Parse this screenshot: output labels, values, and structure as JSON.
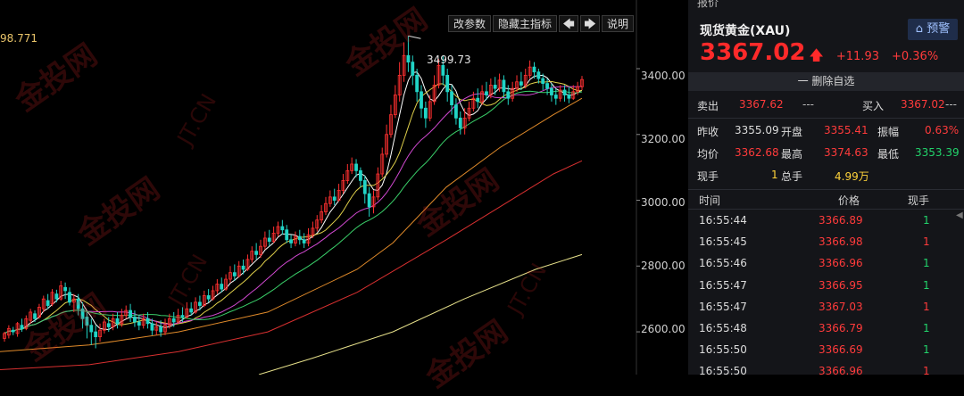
{
  "toolbar": {
    "modify_params": "改参数",
    "hide_indicator": "隐藏主指标",
    "left_arrow": "🡄",
    "right_arrow": "🡆",
    "help": "说明"
  },
  "chart": {
    "top_left_value": "98.771",
    "peak_label": "3499.73"
  },
  "chart_data": {
    "type": "candlestick",
    "peak": 3499.73,
    "y_ticks": [
      "3400.00",
      "3200.00",
      "3000.00",
      "2800.00",
      "2600.00"
    ],
    "ylim": [
      2470,
      3560
    ],
    "candles": [
      [
        2580,
        2595,
        2570,
        2600
      ],
      [
        2590,
        2610,
        2580,
        2620
      ],
      [
        2605,
        2600,
        2590,
        2615
      ],
      [
        2595,
        2625,
        2585,
        2630
      ],
      [
        2620,
        2610,
        2600,
        2640
      ],
      [
        2610,
        2640,
        2605,
        2650
      ],
      [
        2635,
        2660,
        2625,
        2670
      ],
      [
        2655,
        2640,
        2630,
        2665
      ],
      [
        2645,
        2675,
        2640,
        2685
      ],
      [
        2670,
        2700,
        2660,
        2710
      ],
      [
        2695,
        2680,
        2670,
        2715
      ],
      [
        2685,
        2720,
        2678,
        2730
      ],
      [
        2715,
        2700,
        2690,
        2728
      ],
      [
        2700,
        2740,
        2695,
        2755
      ],
      [
        2735,
        2725,
        2700,
        2750
      ],
      [
        2720,
        2690,
        2680,
        2735
      ],
      [
        2690,
        2700,
        2660,
        2715
      ],
      [
        2700,
        2670,
        2650,
        2715
      ],
      [
        2670,
        2640,
        2610,
        2690
      ],
      [
        2645,
        2620,
        2580,
        2660
      ],
      [
        2620,
        2600,
        2560,
        2640
      ],
      [
        2600,
        2585,
        2550,
        2620
      ],
      [
        2585,
        2605,
        2570,
        2625
      ],
      [
        2605,
        2630,
        2595,
        2640
      ],
      [
        2625,
        2615,
        2600,
        2645
      ],
      [
        2615,
        2640,
        2605,
        2655
      ],
      [
        2640,
        2625,
        2610,
        2660
      ],
      [
        2625,
        2650,
        2615,
        2670
      ],
      [
        2650,
        2665,
        2640,
        2680
      ],
      [
        2665,
        2645,
        2630,
        2685
      ],
      [
        2645,
        2630,
        2615,
        2665
      ],
      [
        2630,
        2620,
        2605,
        2650
      ],
      [
        2620,
        2640,
        2610,
        2655
      ],
      [
        2640,
        2625,
        2610,
        2660
      ],
      [
        2625,
        2605,
        2590,
        2640
      ],
      [
        2605,
        2615,
        2590,
        2630
      ],
      [
        2615,
        2600,
        2585,
        2635
      ],
      [
        2600,
        2620,
        2590,
        2640
      ],
      [
        2620,
        2640,
        2610,
        2655
      ],
      [
        2640,
        2630,
        2615,
        2660
      ],
      [
        2630,
        2650,
        2625,
        2670
      ],
      [
        2650,
        2645,
        2630,
        2675
      ],
      [
        2645,
        2670,
        2640,
        2690
      ],
      [
        2670,
        2660,
        2650,
        2690
      ],
      [
        2660,
        2690,
        2655,
        2705
      ],
      [
        2690,
        2680,
        2665,
        2710
      ],
      [
        2680,
        2710,
        2675,
        2725
      ],
      [
        2710,
        2700,
        2690,
        2730
      ],
      [
        2700,
        2725,
        2695,
        2740
      ],
      [
        2725,
        2745,
        2715,
        2760
      ],
      [
        2745,
        2730,
        2720,
        2765
      ],
      [
        2730,
        2760,
        2725,
        2775
      ],
      [
        2760,
        2780,
        2750,
        2800
      ],
      [
        2780,
        2770,
        2755,
        2805
      ],
      [
        2770,
        2800,
        2765,
        2815
      ],
      [
        2800,
        2790,
        2775,
        2820
      ],
      [
        2790,
        2820,
        2785,
        2835
      ],
      [
        2820,
        2845,
        2810,
        2860
      ],
      [
        2845,
        2835,
        2820,
        2870
      ],
      [
        2835,
        2860,
        2825,
        2880
      ],
      [
        2860,
        2885,
        2850,
        2905
      ],
      [
        2885,
        2875,
        2860,
        2910
      ],
      [
        2875,
        2900,
        2870,
        2920
      ],
      [
        2900,
        2920,
        2890,
        2935
      ],
      [
        2920,
        2910,
        2895,
        2940
      ],
      [
        2910,
        2880,
        2870,
        2925
      ],
      [
        2880,
        2870,
        2855,
        2895
      ],
      [
        2870,
        2890,
        2860,
        2905
      ],
      [
        2890,
        2880,
        2865,
        2910
      ],
      [
        2880,
        2870,
        2855,
        2900
      ],
      [
        2870,
        2895,
        2860,
        2915
      ],
      [
        2895,
        2915,
        2885,
        2935
      ],
      [
        2915,
        2940,
        2905,
        2955
      ],
      [
        2940,
        2965,
        2930,
        2985
      ],
      [
        2965,
        2990,
        2955,
        3010
      ],
      [
        2990,
        3010,
        2980,
        3030
      ],
      [
        3010,
        3000,
        2985,
        3035
      ],
      [
        3000,
        3030,
        2995,
        3050
      ],
      [
        3030,
        3060,
        3020,
        3080
      ],
      [
        3060,
        3090,
        3050,
        3110
      ],
      [
        3090,
        3110,
        3080,
        3130
      ],
      [
        3110,
        3090,
        3070,
        3125
      ],
      [
        3090,
        3060,
        3040,
        3100
      ],
      [
        3060,
        3020,
        2990,
        3075
      ],
      [
        3020,
        2980,
        2950,
        3040
      ],
      [
        2980,
        3010,
        2960,
        3030
      ],
      [
        3010,
        3080,
        3000,
        3100
      ],
      [
        3080,
        3140,
        3070,
        3160
      ],
      [
        3140,
        3200,
        3130,
        3230
      ],
      [
        3200,
        3260,
        3190,
        3290
      ],
      [
        3260,
        3320,
        3250,
        3350
      ],
      [
        3320,
        3380,
        3300,
        3420
      ],
      [
        3380,
        3440,
        3360,
        3480
      ],
      [
        3440,
        3420,
        3390,
        3500
      ],
      [
        3420,
        3380,
        3350,
        3440
      ],
      [
        3380,
        3330,
        3300,
        3400
      ],
      [
        3330,
        3280,
        3250,
        3350
      ],
      [
        3280,
        3250,
        3220,
        3300
      ],
      [
        3250,
        3300,
        3240,
        3320
      ],
      [
        3300,
        3350,
        3290,
        3380
      ],
      [
        3350,
        3410,
        3340,
        3430
      ],
      [
        3410,
        3380,
        3350,
        3440
      ],
      [
        3380,
        3330,
        3300,
        3400
      ],
      [
        3330,
        3290,
        3260,
        3350
      ],
      [
        3290,
        3250,
        3230,
        3310
      ],
      [
        3250,
        3220,
        3200,
        3270
      ],
      [
        3220,
        3250,
        3200,
        3280
      ],
      [
        3250,
        3280,
        3240,
        3300
      ],
      [
        3280,
        3310,
        3270,
        3330
      ],
      [
        3310,
        3300,
        3280,
        3340
      ],
      [
        3300,
        3330,
        3290,
        3350
      ],
      [
        3330,
        3320,
        3305,
        3360
      ],
      [
        3320,
        3350,
        3310,
        3370
      ],
      [
        3350,
        3340,
        3320,
        3375
      ],
      [
        3340,
        3365,
        3330,
        3385
      ],
      [
        3365,
        3330,
        3310,
        3380
      ],
      [
        3330,
        3310,
        3290,
        3350
      ],
      [
        3310,
        3340,
        3300,
        3360
      ],
      [
        3340,
        3360,
        3330,
        3380
      ],
      [
        3360,
        3350,
        3335,
        3390
      ],
      [
        3350,
        3380,
        3340,
        3400
      ],
      [
        3380,
        3405,
        3370,
        3425
      ],
      [
        3405,
        3390,
        3370,
        3420
      ],
      [
        3390,
        3370,
        3355,
        3400
      ],
      [
        3370,
        3355,
        3335,
        3385
      ],
      [
        3355,
        3340,
        3320,
        3370
      ],
      [
        3340,
        3320,
        3300,
        3355
      ],
      [
        3320,
        3310,
        3290,
        3340
      ],
      [
        3310,
        3335,
        3300,
        3350
      ],
      [
        3335,
        3320,
        3300,
        3350
      ],
      [
        3320,
        3310,
        3295,
        3345
      ],
      [
        3310,
        3330,
        3305,
        3350
      ],
      [
        3330,
        3345,
        3320,
        3360
      ],
      [
        3345,
        3367,
        3335,
        3378
      ]
    ]
  },
  "panel": {
    "tab": "报价",
    "title": "现货黄金(XAU)",
    "watch_label": "预警",
    "price": "3367.02",
    "price_arrow": "🡅",
    "change": "+11.93",
    "change_pct": "+0.36%",
    "remove_label": "一 删除自选",
    "stats": [
      [
        {
          "l": "卖出",
          "v": "3367.62",
          "c": "red"
        },
        {
          "l": "---",
          "v": "",
          "c": "gray"
        },
        {
          "l": "买入",
          "v": "3367.02",
          "c": "red"
        },
        {
          "l": "---",
          "v": "",
          "c": "gray"
        }
      ],
      [
        {
          "l": "昨收",
          "v": "3355.09",
          "c": "white"
        },
        {
          "l": "开盘",
          "v": "3355.41",
          "c": "red"
        },
        {
          "l": "振幅",
          "v": "0.63%",
          "c": "red"
        }
      ],
      [
        {
          "l": "均价",
          "v": "3362.68",
          "c": "red"
        },
        {
          "l": "最高",
          "v": "3374.63",
          "c": "red"
        },
        {
          "l": "最低",
          "v": "3353.39",
          "c": "green"
        }
      ],
      [
        {
          "l": "现手",
          "v": "1",
          "c": "yellow"
        },
        {
          "l": "总手",
          "v": "4.99万",
          "c": "yellow"
        }
      ]
    ],
    "tick_header": {
      "time": "时间",
      "price": "价格",
      "vol": "现手"
    },
    "ticks": [
      {
        "time": "16:55:44",
        "price": "3366.89",
        "vol": "1"
      },
      {
        "time": "16:55:45",
        "price": "3366.98",
        "vol": "1"
      },
      {
        "time": "16:55:46",
        "price": "3366.96",
        "vol": "1"
      },
      {
        "time": "16:55:47",
        "price": "3366.95",
        "vol": "1"
      },
      {
        "time": "16:55:47",
        "price": "3367.03",
        "vol": "1"
      },
      {
        "time": "16:55:48",
        "price": "3366.79",
        "vol": "1"
      },
      {
        "time": "16:55:50",
        "price": "3366.69",
        "vol": "1"
      },
      {
        "time": "16:55:50",
        "price": "3366.96",
        "vol": "1"
      }
    ]
  },
  "colors": {
    "up": "#ff3030",
    "down": "#21d4c6",
    "accent": "#ff2a2a"
  }
}
